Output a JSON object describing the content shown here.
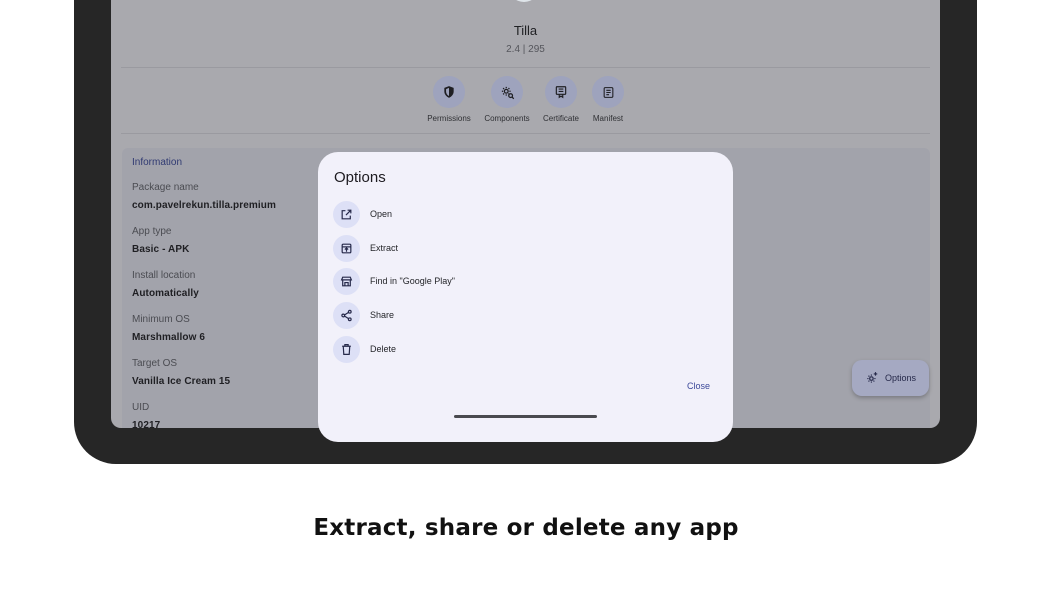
{
  "app": {
    "name": "Tilla",
    "version": "2.4 | 295"
  },
  "quick_actions": [
    {
      "label": "Permissions",
      "icon": "shield-icon"
    },
    {
      "label": "Components",
      "icon": "components-gear-icon"
    },
    {
      "label": "Certificate",
      "icon": "certificate-icon"
    },
    {
      "label": "Manifest",
      "icon": "manifest-icon"
    }
  ],
  "information": {
    "title": "Information",
    "fields": [
      {
        "label": "Package name",
        "value": "com.pavelrekun.tilla.premium"
      },
      {
        "label": "App type",
        "value": "Basic - APK"
      },
      {
        "label": "Install location",
        "value": "Automatically"
      },
      {
        "label": "Minimum OS",
        "value": "Marshmallow 6"
      },
      {
        "label": "Target OS",
        "value": "Vanilla Ice Cream 15"
      },
      {
        "label": "UID",
        "value": "10217"
      }
    ]
  },
  "fab": {
    "label": "Options",
    "icon": "options-gear-icon"
  },
  "dialog": {
    "title": "Options",
    "options": [
      {
        "label": "Open",
        "icon": "open-external-icon"
      },
      {
        "label": "Extract",
        "icon": "extract-archive-icon"
      },
      {
        "label": "Find in \"Google Play\"",
        "icon": "store-icon"
      },
      {
        "label": "Share",
        "icon": "share-icon"
      },
      {
        "label": "Delete",
        "icon": "trash-icon"
      }
    ],
    "close_label": "Close"
  },
  "caption": "Extract, share or delete any app",
  "colors": {
    "accent": "#3d4a9a",
    "dialog_bg": "#f2f1fa",
    "chip_bg": "#dde0f6",
    "device_frame": "#262626"
  }
}
